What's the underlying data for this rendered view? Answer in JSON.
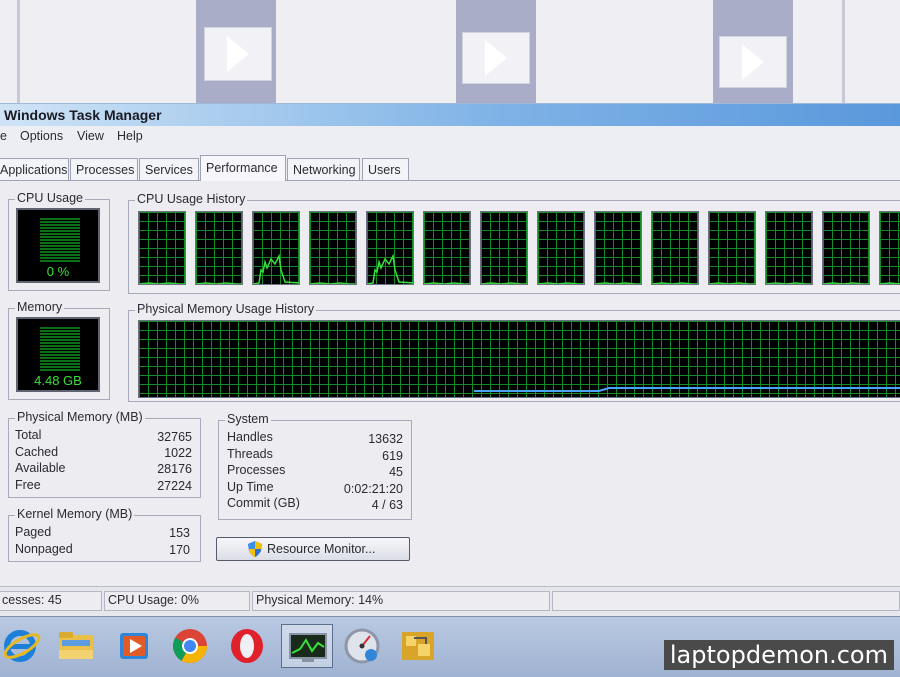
{
  "window": {
    "title": "Windows Task Manager"
  },
  "menu": [
    "e",
    "Options",
    "View",
    "Help"
  ],
  "tabs": [
    "Applications",
    "Processes",
    "Services",
    "Performance",
    "Networking",
    "Users"
  ],
  "active_tab": "Performance",
  "cpu": {
    "group_label": "CPU Usage",
    "value": "0 %"
  },
  "cpu_history": {
    "label": "CPU Usage History",
    "cores": 14
  },
  "memory": {
    "group_label": "Memory",
    "value": "4.48 GB"
  },
  "memory_history": {
    "label": "Physical Memory Usage History"
  },
  "physical_memory": {
    "label": "Physical Memory (MB)",
    "rows": [
      {
        "label": "Total",
        "value": "32765"
      },
      {
        "label": "Cached",
        "value": "1022"
      },
      {
        "label": "Available",
        "value": "28176"
      },
      {
        "label": "Free",
        "value": "27224"
      }
    ]
  },
  "kernel_memory": {
    "label": "Kernel Memory (MB)",
    "rows": [
      {
        "label": "Paged",
        "value": "153"
      },
      {
        "label": "Nonpaged",
        "value": "170"
      }
    ]
  },
  "system": {
    "label": "System",
    "rows": [
      {
        "label": "Handles",
        "value": "13632"
      },
      {
        "label": "Threads",
        "value": "619"
      },
      {
        "label": "Processes",
        "value": "45"
      },
      {
        "label": "Up Time",
        "value": "0:02:21:20"
      },
      {
        "label": "Commit (GB)",
        "value": "4 / 63"
      }
    ]
  },
  "resource_monitor_button": "Resource Monitor...",
  "status": {
    "processes": "cesses: 45",
    "cpu": "CPU Usage: 0%",
    "memory": "Physical Memory: 14%"
  },
  "taskbar": [
    "internet-explorer-icon",
    "file-explorer-icon",
    "media-player-icon",
    "chrome-icon",
    "opera-icon",
    "task-manager-icon",
    "system-gauge-icon",
    "app-icon"
  ],
  "watermark": "laptopdemon.com",
  "colors": {
    "graph_grid": "#128a25",
    "graph_line": "#37e03a",
    "memory_line": "#4aa3ff",
    "title_bar": "#5a98dc"
  }
}
